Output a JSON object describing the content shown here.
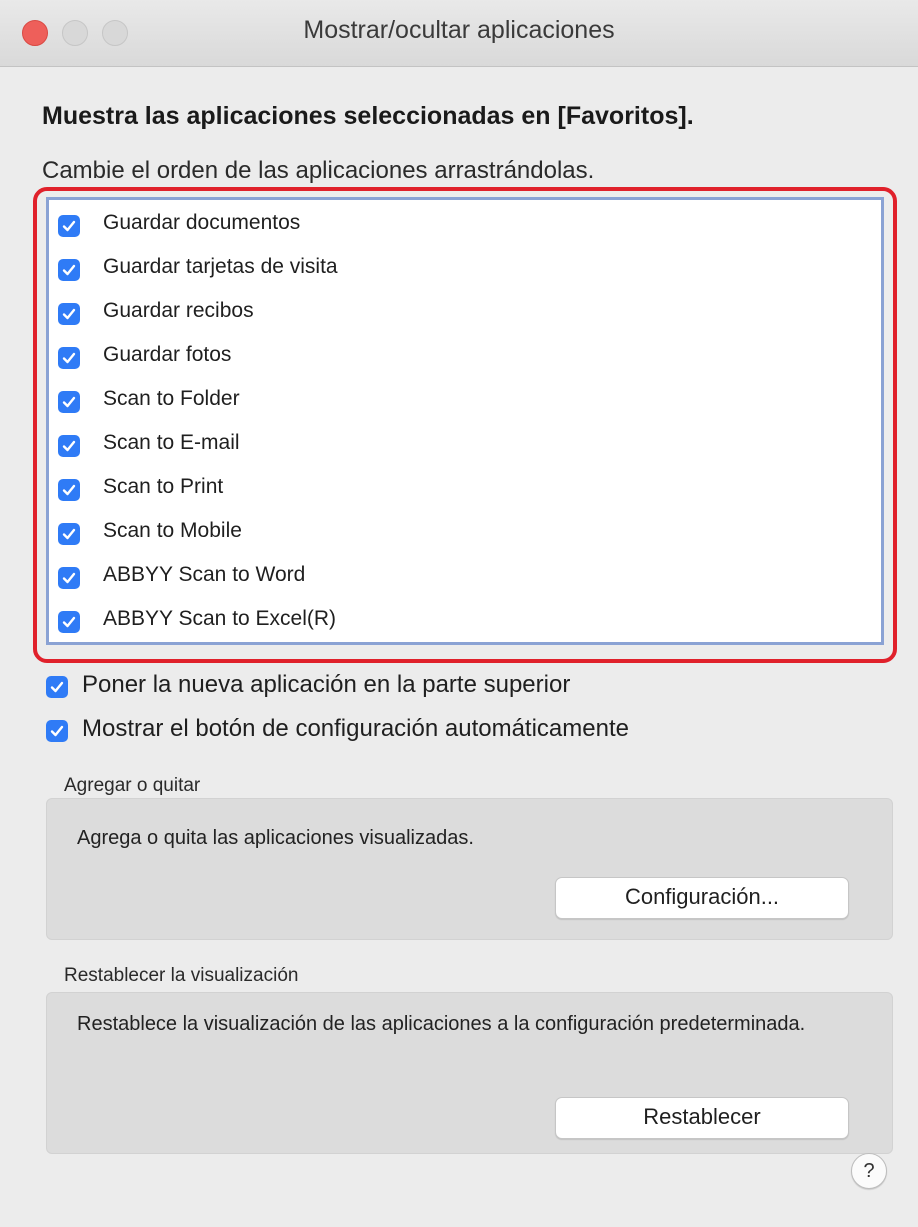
{
  "window": {
    "title": "Mostrar/ocultar aplicaciones"
  },
  "heading": "Muestra las aplicaciones seleccionadas en [Favoritos].",
  "instruction": "Cambie el orden de las aplicaciones arrastrándolas.",
  "apps": [
    {
      "label": "Guardar documentos",
      "checked": true
    },
    {
      "label": "Guardar tarjetas de visita",
      "checked": true
    },
    {
      "label": "Guardar recibos",
      "checked": true
    },
    {
      "label": "Guardar fotos",
      "checked": true
    },
    {
      "label": "Scan to Folder",
      "checked": true
    },
    {
      "label": "Scan to E-mail",
      "checked": true
    },
    {
      "label": "Scan to Print",
      "checked": true
    },
    {
      "label": "Scan to Mobile",
      "checked": true
    },
    {
      "label": "ABBYY Scan to Word",
      "checked": true
    },
    {
      "label": "ABBYY Scan to Excel(R)",
      "checked": true
    }
  ],
  "options": [
    {
      "label": "Poner la nueva aplicación en la parte superior",
      "checked": true
    },
    {
      "label": "Mostrar el botón de configuración automáticamente",
      "checked": true
    }
  ],
  "add_remove": {
    "title": "Agregar o quitar",
    "description": "Agrega o quita las aplicaciones visualizadas.",
    "button": "Configuración..."
  },
  "reset": {
    "title": "Restablecer la visualización",
    "description": "Restablece la visualización de las aplicaciones a la configuración predeterminada.",
    "button": "Restablecer"
  },
  "help": {
    "label": "?"
  },
  "colors": {
    "accent": "#2f7bf6",
    "highlight": "#e0212b",
    "close": "#ee5f5a"
  }
}
